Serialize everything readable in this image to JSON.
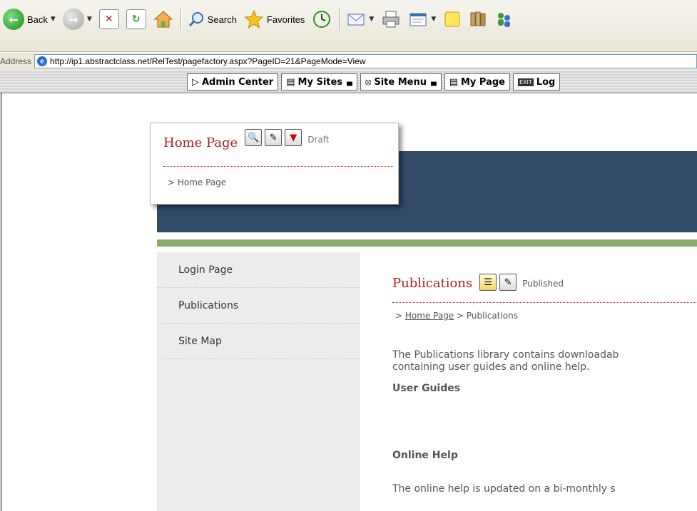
{
  "browser": {
    "toolbar": {
      "back_label": "Back",
      "search_label": "Search",
      "favorites_label": "Favorites"
    },
    "address": {
      "label": "Address",
      "url": "http://ip1.abstractclass.net/RelTest/pagefactory.aspx?PageID=21&PageMode=View"
    }
  },
  "admin_bar": {
    "items": [
      {
        "label": "Admin Center",
        "icon": "admin-icon"
      },
      {
        "label": "My Sites",
        "icon": "sites-icon"
      },
      {
        "label": "Site Menu",
        "icon": "menu-icon"
      },
      {
        "label": "My Page",
        "icon": "page-icon"
      },
      {
        "label": "Log",
        "icon": "exit-icon"
      }
    ]
  },
  "popup": {
    "title": "Home Page",
    "status": "Draft",
    "breadcrumb": "> Home Page"
  },
  "nav": {
    "items": [
      {
        "label": "Login Page"
      },
      {
        "label": "Publications"
      },
      {
        "label": "Site Map"
      }
    ]
  },
  "content": {
    "title": "Publications",
    "status": "Published",
    "crumb_prefix": ">",
    "crumb_link": "Home Page",
    "crumb_tail": "> Publications",
    "intro_line1": "The Publications library contains downloadab",
    "intro_line2": "containing user guides and online help.",
    "section1": "User Guides",
    "section2": "Online Help",
    "section2_text": "The online help is updated on a bi-monthly s"
  },
  "colors": {
    "banner": "#314a66",
    "accent_bar": "#8aac6a",
    "title_red": "#b02020",
    "nav_bg": "#ececec"
  }
}
